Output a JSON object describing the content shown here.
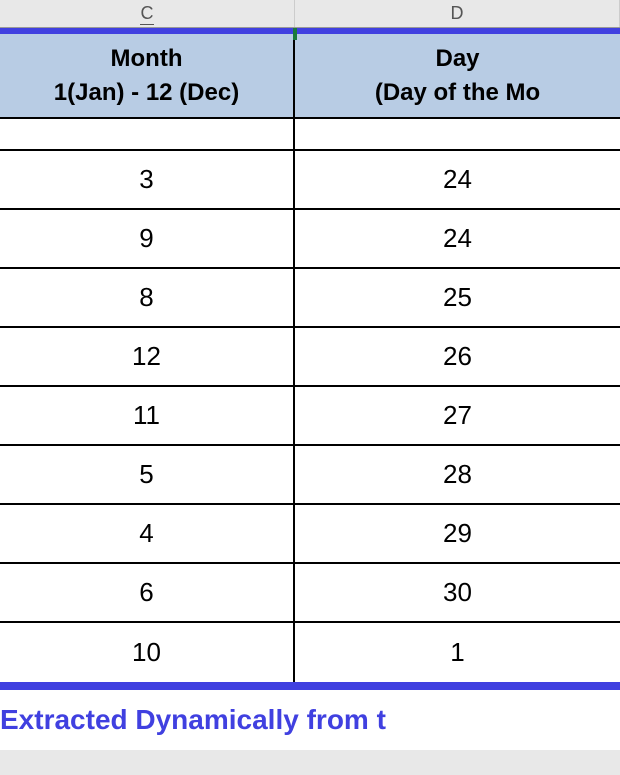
{
  "columns": {
    "c_label": "C",
    "d_label": "D"
  },
  "headers": {
    "month_line1": "Month",
    "month_line2": "1(Jan) - 12 (Dec)",
    "day_line1": "Day",
    "day_line2": "(Day of the Mo"
  },
  "rows": [
    {
      "month": "3",
      "day": "24"
    },
    {
      "month": "9",
      "day": "24"
    },
    {
      "month": "8",
      "day": "25"
    },
    {
      "month": "12",
      "day": "26"
    },
    {
      "month": "11",
      "day": "27"
    },
    {
      "month": "5",
      "day": "28"
    },
    {
      "month": "4",
      "day": "29"
    },
    {
      "month": "6",
      "day": "30"
    },
    {
      "month": "10",
      "day": "1"
    }
  ],
  "footer": {
    "text": "Extracted Dynamically from t"
  },
  "colors": {
    "header_bg": "#b8cce4",
    "border_blue": "#4040e0",
    "footer_text": "#4040e0"
  }
}
